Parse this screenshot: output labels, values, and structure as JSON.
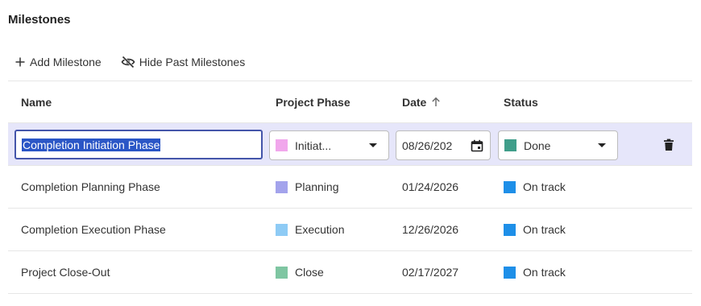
{
  "page": {
    "title": "Milestones"
  },
  "toolbar": {
    "add_label": "Add Milestone",
    "hide_label": "Hide Past Milestones",
    "add_icon": "plus-icon",
    "hide_icon": "eye-off-icon"
  },
  "table": {
    "columns": {
      "name": "Name",
      "phase": "Project Phase",
      "date": "Date",
      "status": "Status"
    },
    "sort": {
      "column": "Date",
      "direction": "ascending"
    },
    "rows": [
      {
        "name": "Completion Initiation Phase",
        "phase": "Initiat...",
        "phase_color": "#f1a7ec",
        "date": "08/26/202",
        "status": "Done",
        "status_color": "#3f9e8a",
        "editing": true
      },
      {
        "name": "Completion Planning Phase",
        "phase": "Planning",
        "phase_color": "#a3a3ec",
        "date": "01/24/2026",
        "status": "On track",
        "status_color": "#1e8fe8"
      },
      {
        "name": "Completion Execution Phase",
        "phase": "Execution",
        "phase_color": "#8ecbf5",
        "date": "12/26/2026",
        "status": "On track",
        "status_color": "#1e8fe8"
      },
      {
        "name": "Project Close-Out",
        "phase": "Close",
        "phase_color": "#7fc6a2",
        "date": "02/17/2027",
        "status": "On track",
        "status_color": "#1e8fe8"
      }
    ]
  },
  "colors": {
    "selected_row": "#e6e6fa",
    "input_border": "#4455aa",
    "text_selection": "#2a56c6"
  }
}
